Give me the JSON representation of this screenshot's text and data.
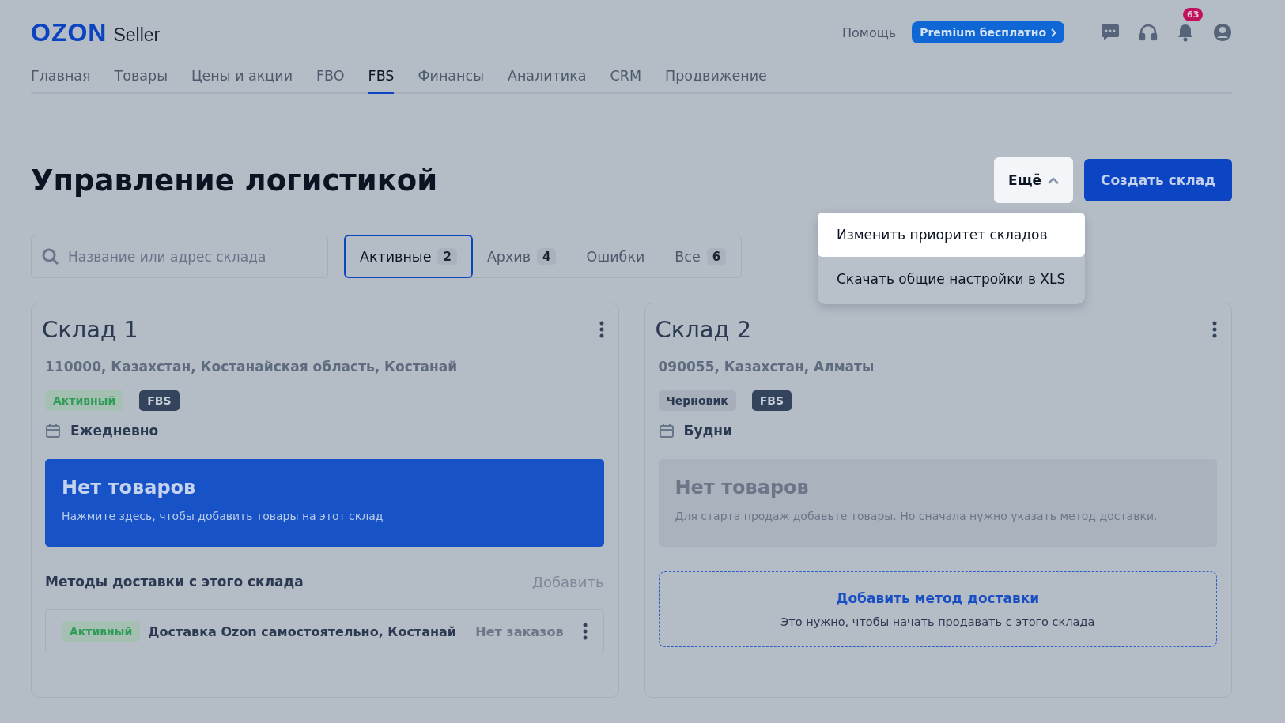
{
  "header": {
    "logo": "OZON",
    "logo_suffix": "Seller",
    "help": "Помощь",
    "premium": "Premium бесплатно",
    "notifications_badge": "63"
  },
  "nav": [
    {
      "label": "Главная",
      "selected": false
    },
    {
      "label": "Товары",
      "selected": false
    },
    {
      "label": "Цены и акции",
      "selected": false
    },
    {
      "label": "FBO",
      "selected": false
    },
    {
      "label": "FBS",
      "selected": true
    },
    {
      "label": "Финансы",
      "selected": false
    },
    {
      "label": "Аналитика",
      "selected": false
    },
    {
      "label": "CRM",
      "selected": false
    },
    {
      "label": "Продвижение",
      "selected": false
    }
  ],
  "title": "Управление логистикой",
  "more_button": {
    "label": "Ещё",
    "expanded": true
  },
  "create_button": "Создать склад",
  "more_menu": [
    {
      "label": "Изменить приоритет складов",
      "selected": true
    },
    {
      "label": "Скачать общие настройки в XLS",
      "selected": false
    }
  ],
  "search": {
    "placeholder": "Название или адрес склада"
  },
  "filters": [
    {
      "label": "Активные",
      "count": "2",
      "selected": true
    },
    {
      "label": "Архив",
      "count": "4",
      "selected": false
    },
    {
      "label": "Ошибки",
      "selected": false
    },
    {
      "label": "Все",
      "count": "6",
      "selected": false
    }
  ],
  "warehouses": [
    {
      "name": "Склад 1",
      "address": "110000, Казахстан, Костанайская область, Костанай",
      "tags": [
        {
          "label": "Активный",
          "kind": "active"
        },
        {
          "label": "FBS",
          "kind": "scheme"
        }
      ],
      "schedule": "Ежедневно",
      "products": {
        "kind": "action",
        "title": "Нет товаров",
        "text": "Нажмите здесь, чтобы добавить товары на этот склад"
      },
      "methods": {
        "title": "Методы доставки с этого склада",
        "add": "Добавить",
        "items": [
          {
            "status": "Активный",
            "name": "Доставка Ozon самостоятельно, Костанай",
            "orders": "Нет заказов"
          }
        ]
      }
    },
    {
      "name": "Склад 2",
      "address": "090055, Казахстан, Алматы",
      "tags": [
        {
          "label": "Черновик",
          "kind": "draft"
        },
        {
          "label": "FBS",
          "kind": "scheme"
        }
      ],
      "schedule": "Будни",
      "products": {
        "kind": "disabled",
        "title": "Нет товаров",
        "text": "Для старта продаж добавьте товары. Но сначала нужно указать метод доставки."
      },
      "add_method": {
        "title": "Добавить метод доставки",
        "text": "Это нужно, чтобы начать продавать с этого склада"
      }
    }
  ]
}
